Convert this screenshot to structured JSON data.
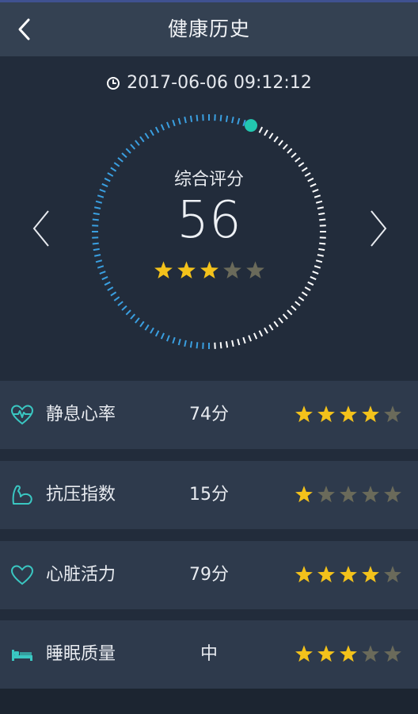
{
  "header": {
    "title": "健康历史",
    "back_icon": "chevron-left-icon"
  },
  "summary": {
    "timestamp": "2017-06-06 09:12:12",
    "label": "综合评分",
    "score": "56",
    "score_percent": 56,
    "stars_filled": 3,
    "stars_total": 5
  },
  "navigation": {
    "prev_icon": "chevron-left-icon",
    "next_icon": "chevron-right-icon"
  },
  "metrics": [
    {
      "icon": "heart-pulse-icon",
      "label": "静息心率",
      "value": "74分",
      "stars_filled": 4
    },
    {
      "icon": "muscle-arm-icon",
      "label": "抗压指数",
      "value": "15分",
      "stars_filled": 1
    },
    {
      "icon": "heart-outline-icon",
      "label": "心脏活力",
      "value": "79分",
      "stars_filled": 4
    },
    {
      "icon": "bed-icon",
      "label": "睡眠质量",
      "value": "中",
      "stars_filled": 3
    }
  ],
  "colors": {
    "background": "#222c3b",
    "header": "#344152",
    "row": "#2e3a4c",
    "star_on": "#f3c21b",
    "star_off": "#6a6a5a",
    "dial_progress": "#3a9fe0",
    "dial_rest": "#ffffff",
    "dial_knob": "#22c7b0",
    "icon_accent": "#3ac7c2"
  }
}
